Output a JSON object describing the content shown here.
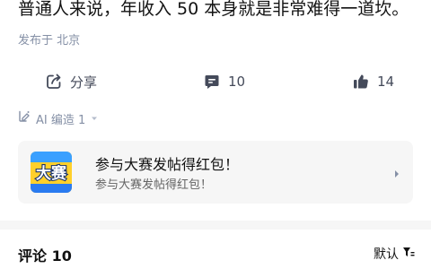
{
  "post": {
    "text": "普通人来说，年收入 50 本身就是非常难得一道坎。",
    "location": "发布于 北京"
  },
  "actions": {
    "share_label": "分享",
    "comment_count": "10",
    "like_count": "14"
  },
  "ai_edit": {
    "label": "AI 编造 1"
  },
  "card": {
    "thumb_text": "大赛",
    "title": "参与大赛发帖得红包！",
    "subtitle": "参与大赛发帖得红包！"
  },
  "comments": {
    "header": "评论 10",
    "sort_label": "默认"
  },
  "icons": {
    "share": "share-icon",
    "comment": "comment-icon",
    "like": "thumbs-up-icon",
    "ai": "ai-edit-icon",
    "chevron": "chevron-down-icon",
    "arrow": "chevron-right-icon",
    "sort": "sort-filter-icon"
  },
  "colors": {
    "accent_blue": "#1772f6",
    "muted": "#8590a6",
    "card_bg": "#f6f6f6"
  }
}
